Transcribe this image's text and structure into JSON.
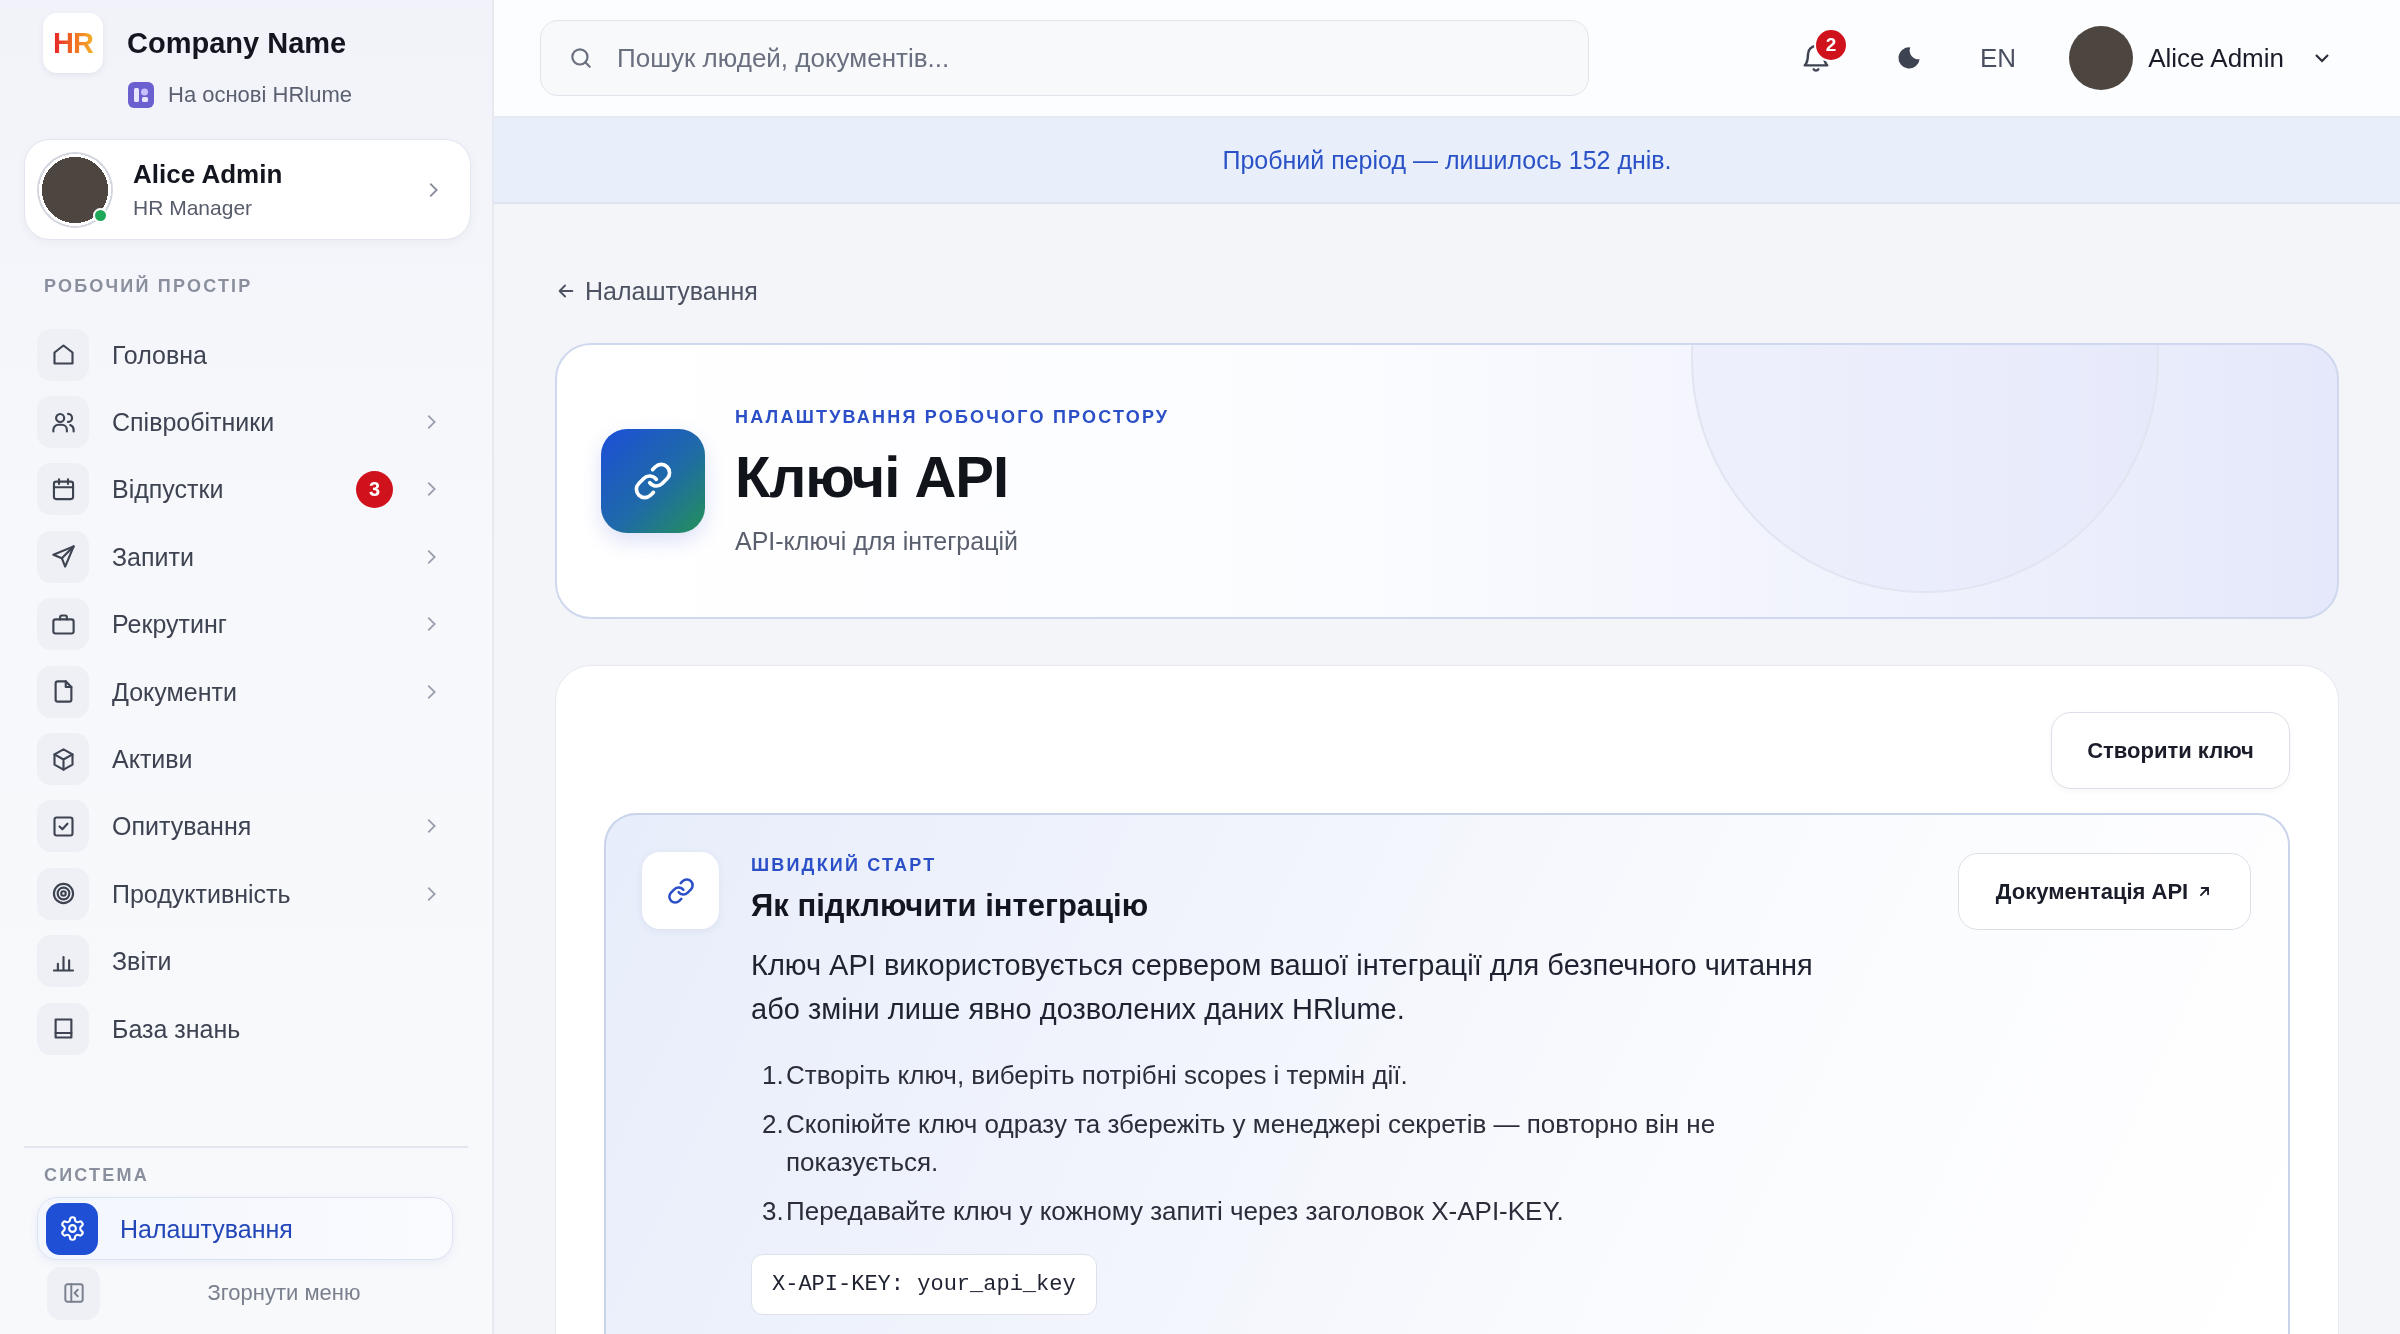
{
  "sidebar": {
    "brand": {
      "logo_text": "HR",
      "name": "Company Name",
      "powered_by": "На основі HRlume"
    },
    "user": {
      "name": "Alice Admin",
      "role": "HR Manager",
      "online": true
    },
    "sections": [
      {
        "title": "РОБОЧИЙ ПРОСТІР",
        "items": [
          {
            "label": "Головна",
            "selected": false,
            "has_submenu": false
          },
          {
            "label": "Співробітники",
            "selected": false,
            "has_submenu": true
          },
          {
            "label": "Відпустки",
            "selected": false,
            "has_submenu": true,
            "badge": "3"
          },
          {
            "label": "Запити",
            "selected": false,
            "has_submenu": true
          },
          {
            "label": "Рекрутинг",
            "selected": false,
            "has_submenu": true
          },
          {
            "label": "Документи",
            "selected": false,
            "has_submenu": true
          },
          {
            "label": "Активи",
            "selected": false,
            "has_submenu": false
          },
          {
            "label": "Опитування",
            "selected": false,
            "has_submenu": true
          },
          {
            "label": "Продуктивність",
            "selected": false,
            "has_submenu": true
          },
          {
            "label": "Звіти",
            "selected": false,
            "has_submenu": false
          },
          {
            "label": "База знань",
            "selected": false,
            "has_submenu": false
          }
        ]
      },
      {
        "title": "СИСТЕМА",
        "items": [
          {
            "label": "Налаштування",
            "selected": true,
            "has_submenu": false
          }
        ]
      }
    ],
    "collapse_label": "Згорнути меню"
  },
  "topbar": {
    "search": {
      "placeholder": "Пошук людей, документів..."
    },
    "notifications": {
      "count": "2"
    },
    "language": "EN",
    "user": {
      "name": "Alice Admin"
    }
  },
  "trial_banner": {
    "text": "Пробний період — лишилось 152 днів."
  },
  "back_link": {
    "label": "Налаштування"
  },
  "page_header": {
    "eyebrow": "НАЛАШТУВАННЯ РОБОЧОГО ПРОСТОРУ",
    "title": "Ключі API",
    "subtitle": "API-ключі для інтеграцій"
  },
  "api_keys": {
    "create_button": "Створити ключ",
    "quick_start": {
      "eyebrow": "ШВИДКИЙ СТАРТ",
      "title": "Як підключити інтеграцію",
      "description": "Ключ API використовується сервером вашої інтеграції для безпечного читання або зміни лише явно дозволених даних HRlume.",
      "docs_button": "Документація API",
      "steps": [
        {
          "number": "1.",
          "text": "Створіть ключ, виберіть потрібні scopes і термін дії."
        },
        {
          "number": "2.",
          "text": "Скопіюйте ключ одразу та збережіть у менеджері секретів — повторно він не показується."
        },
        {
          "number": "3.",
          "text": "Передавайте ключ у кожному запиті через заголовок X-API-KEY."
        }
      ],
      "code": "X-API-KEY: your_api_key"
    }
  }
}
